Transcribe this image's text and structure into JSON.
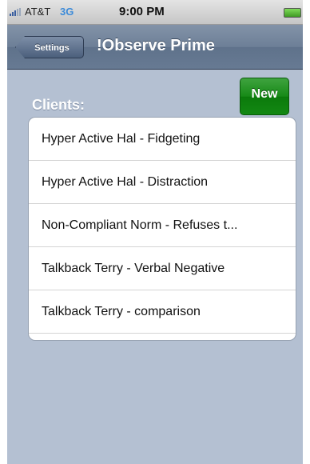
{
  "status_bar": {
    "carrier": "AT&T",
    "network": "3G",
    "time": "9:00 PM"
  },
  "nav_bar": {
    "back_label": "Settings",
    "title": "!Observe Prime"
  },
  "clients": {
    "section_title": "Clients:",
    "new_label": "New",
    "items": [
      {
        "label": "Hyper Active Hal - Fidgeting"
      },
      {
        "label": "Hyper Active Hal - Distraction"
      },
      {
        "label": "Non-Compliant Norm - Refuses t..."
      },
      {
        "label": "Talkback Terry - Verbal Negative"
      },
      {
        "label": "Talkback Terry - comparison"
      }
    ]
  },
  "icons": {
    "signal": "signal-icon",
    "battery": "battery-icon"
  },
  "colors": {
    "nav_bar": "#6d7f97",
    "background": "#b4c0d2",
    "new_button": "#178a17",
    "network_label": "#3d8bd8"
  }
}
